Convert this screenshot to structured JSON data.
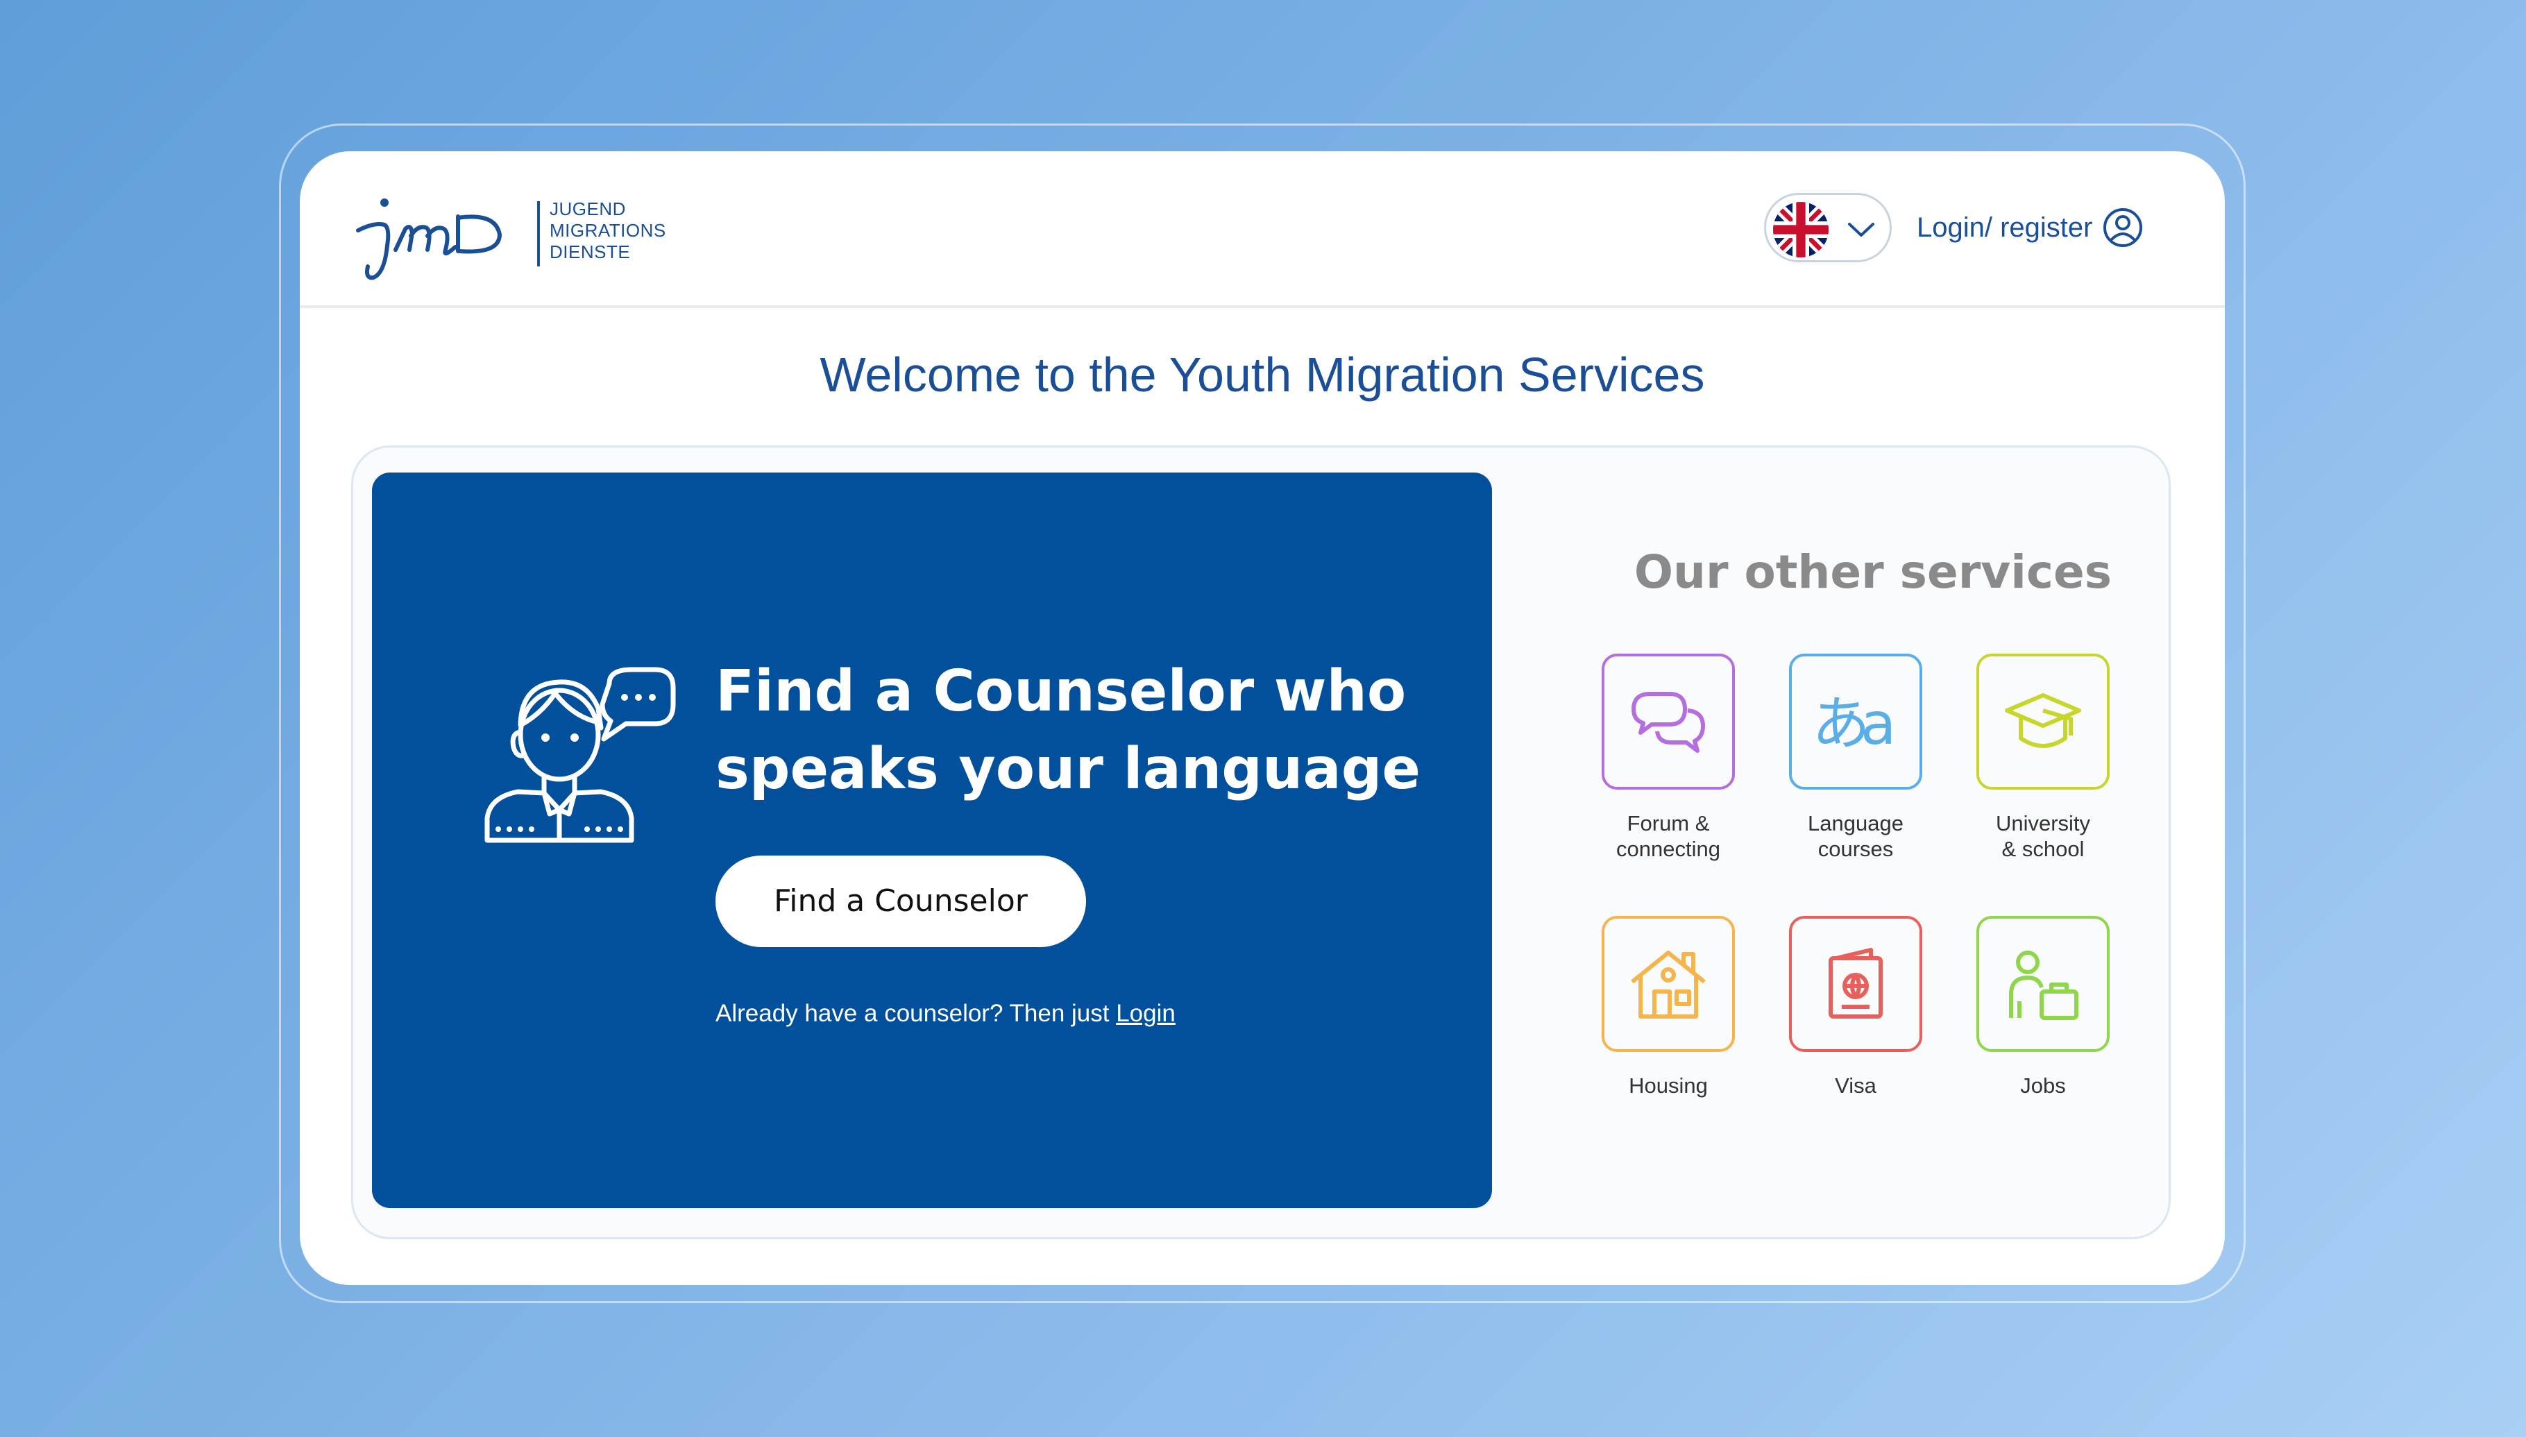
{
  "header": {
    "logo_mark": "jmd",
    "logo_lines": [
      "JUGEND",
      "MIGRATIONS",
      "DIENSTE"
    ],
    "language": {
      "selected": "English",
      "flag_icon": "uk-flag-icon"
    },
    "login_label": "Login/ register"
  },
  "page": {
    "title": "Welcome to the Youth Migration Services"
  },
  "hero": {
    "title_line1": "Find a Counselor who",
    "title_line2": "speaks your language",
    "button_label": "Find a Counselor",
    "note_text": "Already have a counselor? Then just ",
    "note_link": "Login"
  },
  "services": {
    "title": "Our other services",
    "items": [
      {
        "line1": "Forum &",
        "line2": "connecting",
        "icon": "chat-bubbles-icon",
        "color": "#b56ee0"
      },
      {
        "line1": "Language",
        "line2": "courses",
        "icon": "language-icon",
        "color": "#5aaee8"
      },
      {
        "line1": "University",
        "line2": "& school",
        "icon": "graduation-cap-icon",
        "color": "#c6d62a"
      },
      {
        "line1": "Housing",
        "line2": "",
        "icon": "house-icon",
        "color": "#f5b54a"
      },
      {
        "line1": "Visa",
        "line2": "",
        "icon": "passport-icon",
        "color": "#e8605c"
      },
      {
        "line1": "Jobs",
        "line2": "",
        "icon": "worker-briefcase-icon",
        "color": "#8fd64a"
      }
    ]
  },
  "colors": {
    "brand_blue": "#1a4f98",
    "hero_blue": "#02509b",
    "background_gradient_start": "#5f9ed9",
    "background_gradient_end": "#a9cff4"
  }
}
